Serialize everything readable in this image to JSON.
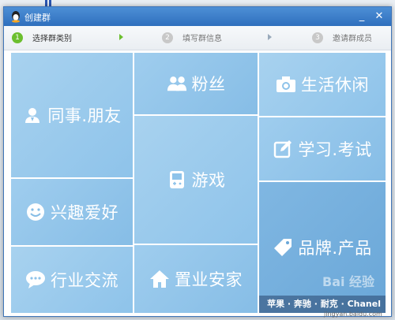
{
  "window": {
    "title": "创建群",
    "minimize_glyph": "_",
    "close_glyph": "✕"
  },
  "steps": [
    {
      "number": "1",
      "label": "选择群类别",
      "active": true
    },
    {
      "number": "2",
      "label": "填写群信息",
      "active": false
    },
    {
      "number": "3",
      "label": "邀请群成员",
      "active": false
    }
  ],
  "tiles": {
    "colleagues": {
      "label": "同事.朋友",
      "icon": "contact-icon"
    },
    "fans": {
      "label": "粉丝",
      "icon": "users-icon"
    },
    "life": {
      "label": "生活休闲",
      "icon": "camera-icon"
    },
    "interests": {
      "label": "兴趣爱好",
      "icon": "smiley-icon"
    },
    "games": {
      "label": "游戏",
      "icon": "gamepad-icon"
    },
    "study": {
      "label": "学习.考试",
      "icon": "edit-icon"
    },
    "industry": {
      "label": "行业交流",
      "icon": "chat-bubble-icon"
    },
    "realestate": {
      "label": "置业安家",
      "icon": "home-icon"
    },
    "brands": {
      "label": "品牌.产品",
      "icon": "tag-icon",
      "caption": "苹果 · 奔驰 · 耐克 · Chanel"
    }
  },
  "watermark": {
    "text": "Bai 经验",
    "sub": "jingyan.baidu.com"
  },
  "colors": {
    "titlebar": "#2f6fbd",
    "tile_light": "#a8d2ef",
    "tile_dark": "#6aa7d8",
    "step_active": "#6cbf2e"
  }
}
